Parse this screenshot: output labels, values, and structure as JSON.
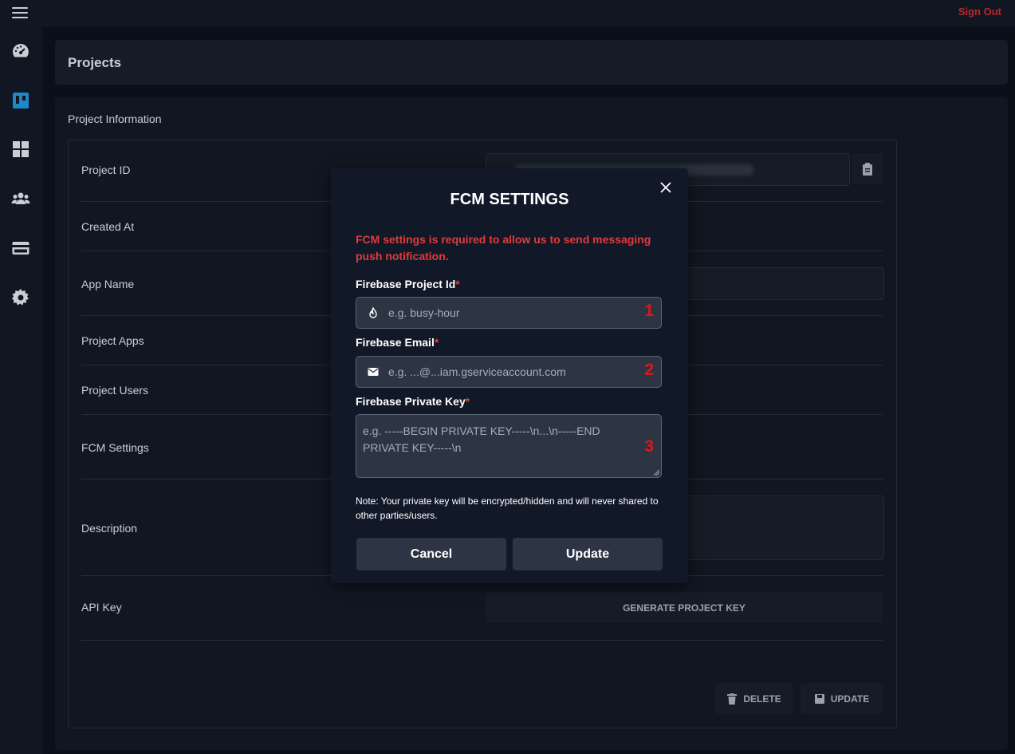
{
  "topbar": {
    "menu_icon": "hamburger-menu-icon",
    "sign_out": "Sign Out"
  },
  "sidebar": {
    "items": [
      {
        "name": "dashboard",
        "icon": "speedometer-icon",
        "active": false
      },
      {
        "name": "projects",
        "icon": "trello-board-icon",
        "active": true
      },
      {
        "name": "apps",
        "icon": "grid-icon",
        "active": false
      },
      {
        "name": "users",
        "icon": "users-icon",
        "active": false
      },
      {
        "name": "billing",
        "icon": "credit-card-icon",
        "active": false
      },
      {
        "name": "settings",
        "icon": "gear-icon",
        "active": false
      }
    ],
    "accent_color": "#1e88c7"
  },
  "header": {
    "title": "Projects"
  },
  "project_info": {
    "title": "Project Information",
    "rows": [
      {
        "label": "Project ID"
      },
      {
        "label": "Created At"
      },
      {
        "label": "App Name"
      },
      {
        "label": "Project Apps"
      },
      {
        "label": "Project Users"
      },
      {
        "label": "FCM Settings"
      },
      {
        "label": "Description"
      },
      {
        "label": "API Key"
      }
    ],
    "generate_key_button": "GENERATE PROJECT KEY",
    "delete_button": "DELETE",
    "update_button": "UPDATE"
  },
  "modal": {
    "title": "FCM SETTINGS",
    "warning": "FCM settings is required to allow us to send messaging push notification.",
    "fields": [
      {
        "label": "Firebase Project Id",
        "required_mark": "*",
        "placeholder": "e.g. busy-hour",
        "icon": "fire-icon",
        "number": "1"
      },
      {
        "label": "Firebase Email",
        "required_mark": "*",
        "placeholder": "e.g. ...@...iam.gserviceaccount.com",
        "icon": "envelope-icon",
        "number": "2"
      },
      {
        "label": "Firebase Private Key",
        "required_mark": "*",
        "placeholder": "e.g. -----BEGIN PRIVATE KEY-----\\n...\\n-----END PRIVATE KEY-----\\n",
        "number": "3"
      }
    ],
    "note": "Note: Your private key will be encrypted/hidden and will never shared to other parties/users.",
    "cancel": "Cancel",
    "update": "Update"
  },
  "colors": {
    "required": "#e03c3c",
    "annotation": "#e0161c",
    "sign_out": "#b8282e"
  }
}
